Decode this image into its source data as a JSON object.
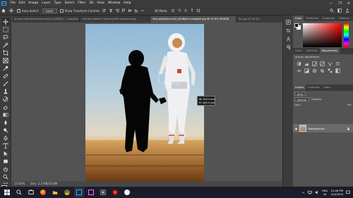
{
  "app": {
    "logo": "Ps",
    "menu": [
      "File",
      "Edit",
      "Image",
      "Layer",
      "Type",
      "Select",
      "Filter",
      "3D",
      "View",
      "Window",
      "Help"
    ],
    "window_controls": [
      "—",
      "❐",
      "✕"
    ]
  },
  "options": {
    "auto_select_label": "Auto-Select:",
    "auto_select_value": "Layer",
    "transform_label": "Show Transform Controls",
    "mode_3d": "3D Mode:"
  },
  "tabs": [
    {
      "label": "almost-rightshadowtovar.toe(1)/WEB(4 ...snapshot.jpg",
      "active": false
    },
    {
      "label": "clambo debelor (Sjjnton/WEB snapshot.jpg",
      "active": false
    },
    {
      "label": "nike-pellegrino-m0_uFiv8de2-unsplash.jpg @ 15.6% (RGB/8)",
      "active": true
    },
    {
      "label": "Rio.jpg @ 18.3%",
      "active": false
    }
  ],
  "tooltip": {
    "line1": "W: 203.3 mm",
    "line2": "H: 449.0 mm"
  },
  "status": {
    "zoom": "15.63%",
    "info": "Doc: 2.3 MB/16.8M"
  },
  "panels": {
    "color_tabs": [
      "Color",
      "Swatches",
      "Gradients",
      "Patterns"
    ],
    "adj_tabs": [
      "Learn",
      "Libraries",
      "Adjustments"
    ],
    "adj_label": "Add an adjustment",
    "layers_tabs": [
      "Layers",
      "Channels",
      "Paths"
    ],
    "kind_label": "Kind",
    "blend_mode": "Normal",
    "opacity_label": "Opacity:",
    "lock_label": "Lock:",
    "fill_label": "Fill:",
    "layer_name": "Background",
    "layer_visibility": "◉"
  },
  "taskbar": {
    "time": "12:46 PM",
    "date": "5/4/2020",
    "lang": "ENG",
    "region": "IN"
  },
  "colors": {
    "accent": "#31a8ff",
    "ps_dark": "#0d2d4a"
  }
}
